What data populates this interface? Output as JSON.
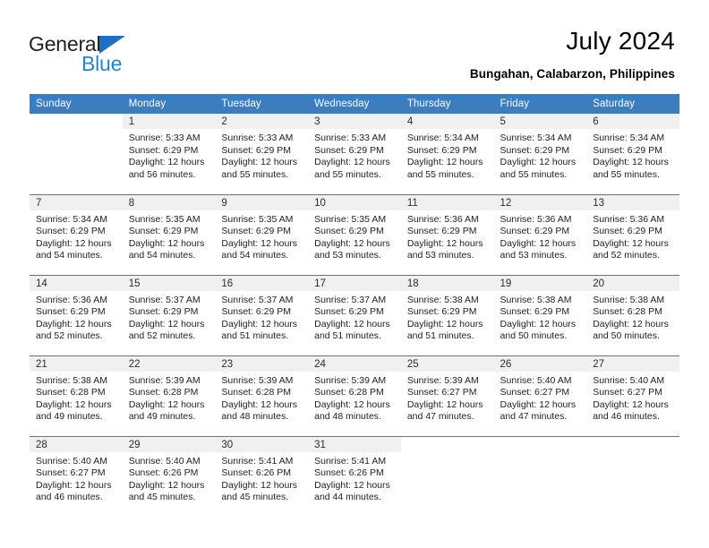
{
  "brand": {
    "name_dark": "General",
    "name_blue": "Blue",
    "accent_blue": "#2585d3",
    "triangle_blue": "#1f6fc4"
  },
  "header": {
    "title": "July 2024",
    "subtitle": "Bungahan, Calabarzon, Philippines"
  },
  "calendar": {
    "header_bg": "#3b7dbf",
    "daynum_bg": "#f0f0f0",
    "weekday_headers": [
      "Sunday",
      "Monday",
      "Tuesday",
      "Wednesday",
      "Thursday",
      "Friday",
      "Saturday"
    ],
    "weeks": [
      [
        {
          "day": "",
          "sunrise": "",
          "sunset": "",
          "daylight1": "",
          "daylight2": ""
        },
        {
          "day": "1",
          "sunrise": "Sunrise: 5:33 AM",
          "sunset": "Sunset: 6:29 PM",
          "daylight1": "Daylight: 12 hours",
          "daylight2": "and 56 minutes."
        },
        {
          "day": "2",
          "sunrise": "Sunrise: 5:33 AM",
          "sunset": "Sunset: 6:29 PM",
          "daylight1": "Daylight: 12 hours",
          "daylight2": "and 55 minutes."
        },
        {
          "day": "3",
          "sunrise": "Sunrise: 5:33 AM",
          "sunset": "Sunset: 6:29 PM",
          "daylight1": "Daylight: 12 hours",
          "daylight2": "and 55 minutes."
        },
        {
          "day": "4",
          "sunrise": "Sunrise: 5:34 AM",
          "sunset": "Sunset: 6:29 PM",
          "daylight1": "Daylight: 12 hours",
          "daylight2": "and 55 minutes."
        },
        {
          "day": "5",
          "sunrise": "Sunrise: 5:34 AM",
          "sunset": "Sunset: 6:29 PM",
          "daylight1": "Daylight: 12 hours",
          "daylight2": "and 55 minutes."
        },
        {
          "day": "6",
          "sunrise": "Sunrise: 5:34 AM",
          "sunset": "Sunset: 6:29 PM",
          "daylight1": "Daylight: 12 hours",
          "daylight2": "and 55 minutes."
        }
      ],
      [
        {
          "day": "7",
          "sunrise": "Sunrise: 5:34 AM",
          "sunset": "Sunset: 6:29 PM",
          "daylight1": "Daylight: 12 hours",
          "daylight2": "and 54 minutes."
        },
        {
          "day": "8",
          "sunrise": "Sunrise: 5:35 AM",
          "sunset": "Sunset: 6:29 PM",
          "daylight1": "Daylight: 12 hours",
          "daylight2": "and 54 minutes."
        },
        {
          "day": "9",
          "sunrise": "Sunrise: 5:35 AM",
          "sunset": "Sunset: 6:29 PM",
          "daylight1": "Daylight: 12 hours",
          "daylight2": "and 54 minutes."
        },
        {
          "day": "10",
          "sunrise": "Sunrise: 5:35 AM",
          "sunset": "Sunset: 6:29 PM",
          "daylight1": "Daylight: 12 hours",
          "daylight2": "and 53 minutes."
        },
        {
          "day": "11",
          "sunrise": "Sunrise: 5:36 AM",
          "sunset": "Sunset: 6:29 PM",
          "daylight1": "Daylight: 12 hours",
          "daylight2": "and 53 minutes."
        },
        {
          "day": "12",
          "sunrise": "Sunrise: 5:36 AM",
          "sunset": "Sunset: 6:29 PM",
          "daylight1": "Daylight: 12 hours",
          "daylight2": "and 53 minutes."
        },
        {
          "day": "13",
          "sunrise": "Sunrise: 5:36 AM",
          "sunset": "Sunset: 6:29 PM",
          "daylight1": "Daylight: 12 hours",
          "daylight2": "and 52 minutes."
        }
      ],
      [
        {
          "day": "14",
          "sunrise": "Sunrise: 5:36 AM",
          "sunset": "Sunset: 6:29 PM",
          "daylight1": "Daylight: 12 hours",
          "daylight2": "and 52 minutes."
        },
        {
          "day": "15",
          "sunrise": "Sunrise: 5:37 AM",
          "sunset": "Sunset: 6:29 PM",
          "daylight1": "Daylight: 12 hours",
          "daylight2": "and 52 minutes."
        },
        {
          "day": "16",
          "sunrise": "Sunrise: 5:37 AM",
          "sunset": "Sunset: 6:29 PM",
          "daylight1": "Daylight: 12 hours",
          "daylight2": "and 51 minutes."
        },
        {
          "day": "17",
          "sunrise": "Sunrise: 5:37 AM",
          "sunset": "Sunset: 6:29 PM",
          "daylight1": "Daylight: 12 hours",
          "daylight2": "and 51 minutes."
        },
        {
          "day": "18",
          "sunrise": "Sunrise: 5:38 AM",
          "sunset": "Sunset: 6:29 PM",
          "daylight1": "Daylight: 12 hours",
          "daylight2": "and 51 minutes."
        },
        {
          "day": "19",
          "sunrise": "Sunrise: 5:38 AM",
          "sunset": "Sunset: 6:29 PM",
          "daylight1": "Daylight: 12 hours",
          "daylight2": "and 50 minutes."
        },
        {
          "day": "20",
          "sunrise": "Sunrise: 5:38 AM",
          "sunset": "Sunset: 6:28 PM",
          "daylight1": "Daylight: 12 hours",
          "daylight2": "and 50 minutes."
        }
      ],
      [
        {
          "day": "21",
          "sunrise": "Sunrise: 5:38 AM",
          "sunset": "Sunset: 6:28 PM",
          "daylight1": "Daylight: 12 hours",
          "daylight2": "and 49 minutes."
        },
        {
          "day": "22",
          "sunrise": "Sunrise: 5:39 AM",
          "sunset": "Sunset: 6:28 PM",
          "daylight1": "Daylight: 12 hours",
          "daylight2": "and 49 minutes."
        },
        {
          "day": "23",
          "sunrise": "Sunrise: 5:39 AM",
          "sunset": "Sunset: 6:28 PM",
          "daylight1": "Daylight: 12 hours",
          "daylight2": "and 48 minutes."
        },
        {
          "day": "24",
          "sunrise": "Sunrise: 5:39 AM",
          "sunset": "Sunset: 6:28 PM",
          "daylight1": "Daylight: 12 hours",
          "daylight2": "and 48 minutes."
        },
        {
          "day": "25",
          "sunrise": "Sunrise: 5:39 AM",
          "sunset": "Sunset: 6:27 PM",
          "daylight1": "Daylight: 12 hours",
          "daylight2": "and 47 minutes."
        },
        {
          "day": "26",
          "sunrise": "Sunrise: 5:40 AM",
          "sunset": "Sunset: 6:27 PM",
          "daylight1": "Daylight: 12 hours",
          "daylight2": "and 47 minutes."
        },
        {
          "day": "27",
          "sunrise": "Sunrise: 5:40 AM",
          "sunset": "Sunset: 6:27 PM",
          "daylight1": "Daylight: 12 hours",
          "daylight2": "and 46 minutes."
        }
      ],
      [
        {
          "day": "28",
          "sunrise": "Sunrise: 5:40 AM",
          "sunset": "Sunset: 6:27 PM",
          "daylight1": "Daylight: 12 hours",
          "daylight2": "and 46 minutes."
        },
        {
          "day": "29",
          "sunrise": "Sunrise: 5:40 AM",
          "sunset": "Sunset: 6:26 PM",
          "daylight1": "Daylight: 12 hours",
          "daylight2": "and 45 minutes."
        },
        {
          "day": "30",
          "sunrise": "Sunrise: 5:41 AM",
          "sunset": "Sunset: 6:26 PM",
          "daylight1": "Daylight: 12 hours",
          "daylight2": "and 45 minutes."
        },
        {
          "day": "31",
          "sunrise": "Sunrise: 5:41 AM",
          "sunset": "Sunset: 6:26 PM",
          "daylight1": "Daylight: 12 hours",
          "daylight2": "and 44 minutes."
        },
        {
          "day": "",
          "sunrise": "",
          "sunset": "",
          "daylight1": "",
          "daylight2": ""
        },
        {
          "day": "",
          "sunrise": "",
          "sunset": "",
          "daylight1": "",
          "daylight2": ""
        },
        {
          "day": "",
          "sunrise": "",
          "sunset": "",
          "daylight1": "",
          "daylight2": ""
        }
      ]
    ]
  }
}
